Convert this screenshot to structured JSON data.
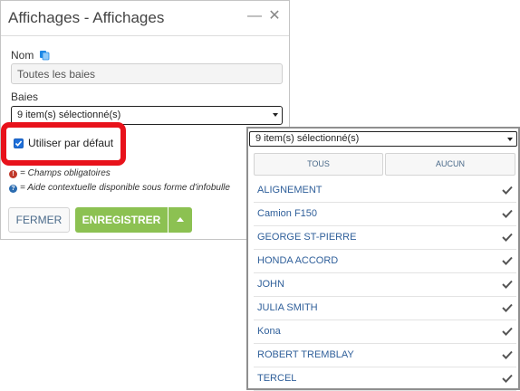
{
  "dialog": {
    "title": "Affichages - Affichages",
    "name_label": "Nom",
    "name_value": "Toutes les baies",
    "bays_label": "Baies",
    "bays_selected": "9 item(s) sélectionné(s)",
    "default_checkbox_label": "Utiliser par défaut",
    "default_checked": true,
    "note_required": "= Champs obligatoires",
    "note_help": "= Aide contextuelle disponible sous forme d'infobulle",
    "close_label": "FERMER",
    "save_label": "ENREGISTRER"
  },
  "dropdown": {
    "selected_text": "9 item(s) sélectionné(s)",
    "all_label": "TOUS",
    "none_label": "AUCUN",
    "items": [
      {
        "label": "ALIGNEMENT",
        "checked": true
      },
      {
        "label": "Camion F150",
        "checked": true
      },
      {
        "label": "GEORGE ST-PIERRE",
        "checked": true
      },
      {
        "label": "HONDA ACCORD",
        "checked": true
      },
      {
        "label": "JOHN",
        "checked": true
      },
      {
        "label": "JULIA SMITH",
        "checked": true
      },
      {
        "label": "Kona",
        "checked": true
      },
      {
        "label": "ROBERT TREMBLAY",
        "checked": true
      },
      {
        "label": "TERCEL",
        "checked": true
      }
    ]
  },
  "colors": {
    "accent_green": "#8cc152",
    "highlight_red": "#e8121b",
    "link_blue": "#2f5f9a"
  }
}
